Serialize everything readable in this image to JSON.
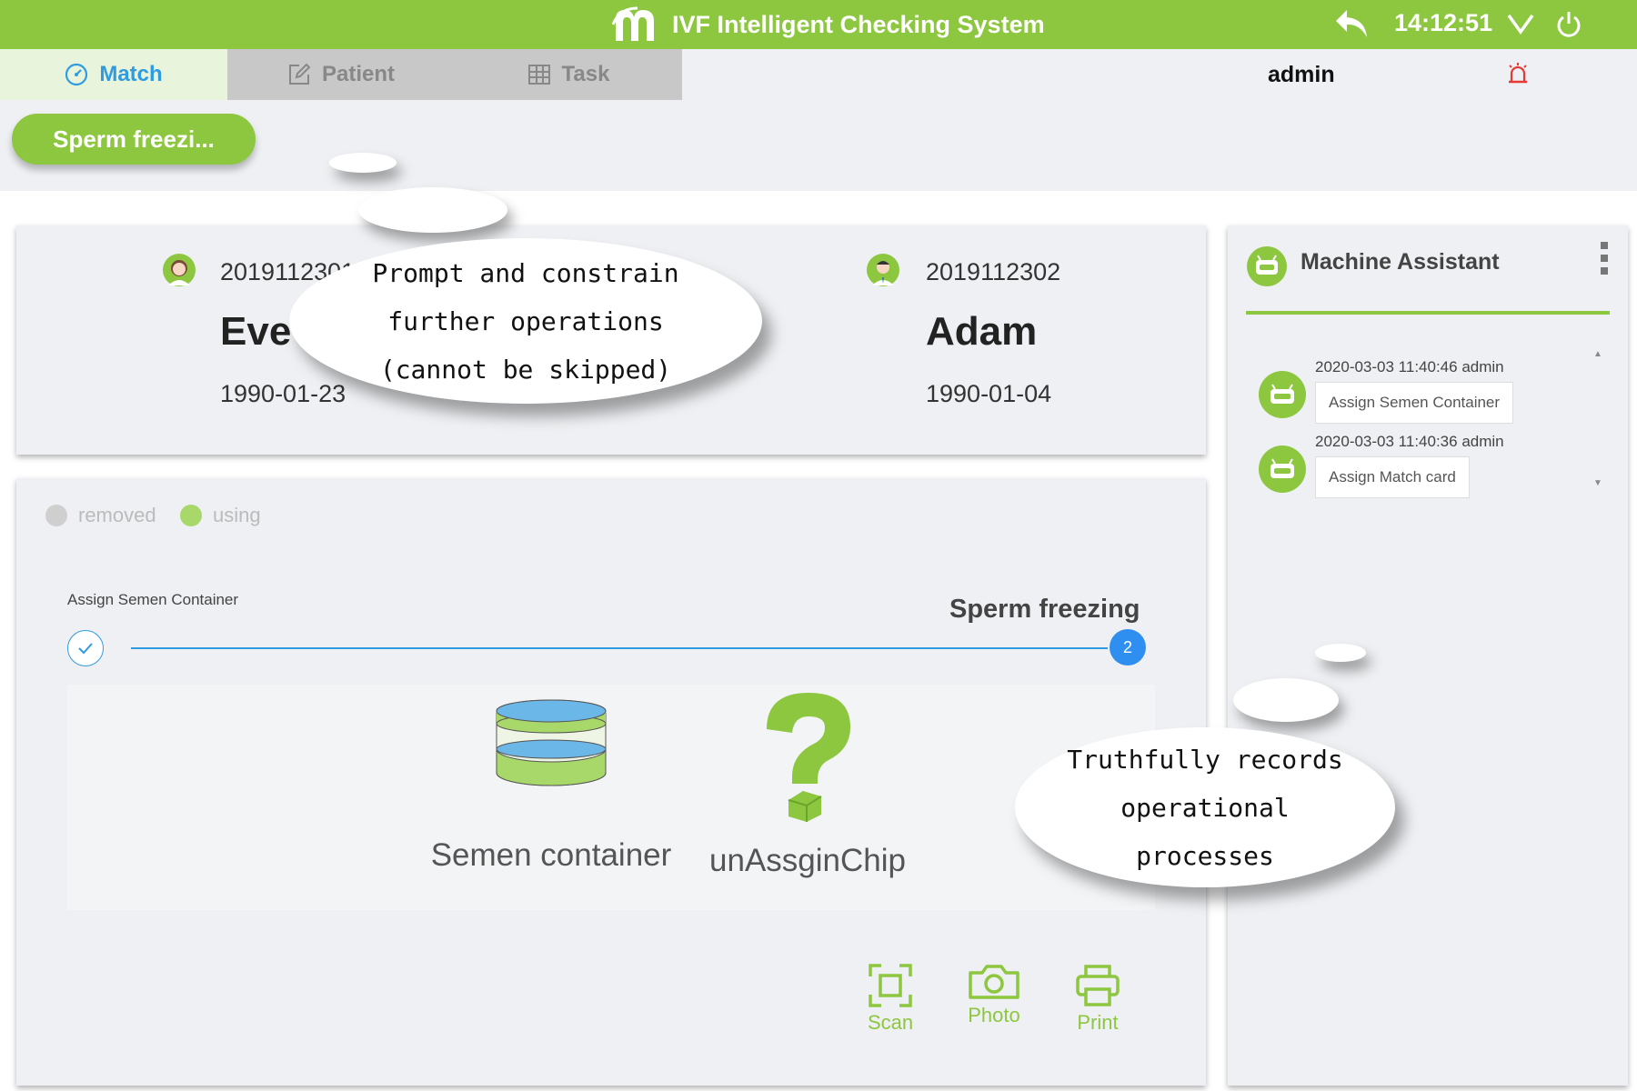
{
  "header": {
    "title": "IVF Intelligent Checking System",
    "time": "14:12:51",
    "icons": [
      "logo-icon",
      "back-icon",
      "chevron-down-icon",
      "power-icon"
    ]
  },
  "tabs": [
    {
      "label": "Match",
      "icon": "dashboard-icon",
      "active": true
    },
    {
      "label": "Patient",
      "icon": "edit-icon",
      "active": false
    },
    {
      "label": "Task",
      "icon": "table-icon",
      "active": false
    }
  ],
  "user": {
    "name": "admin",
    "alarm_icon": "alarm-icon"
  },
  "task_pill": "Sperm freezi...",
  "patients": {
    "female": {
      "id": "2019112301",
      "name": "Eve",
      "dob": "1990-01-23"
    },
    "male": {
      "id": "2019112302",
      "name": "Adam",
      "dob": "1990-01-04"
    }
  },
  "legend": {
    "removed": "removed",
    "using": "using"
  },
  "steps": {
    "done_label": "Assign Semen Container",
    "current_label": "Sperm freezing",
    "current_number": "2"
  },
  "items": {
    "container": "Semen container",
    "chip": "unAssginChip"
  },
  "actions": {
    "scan": "Scan",
    "photo": "Photo",
    "print": "Print"
  },
  "assistant": {
    "title": "Machine Assistant",
    "logs": [
      {
        "meta": "2020-03-03 11:40:46 admin",
        "message": "Assign Semen Container"
      },
      {
        "meta": "2020-03-03 11:40:36 admin",
        "message": "Assign Match card"
      }
    ]
  },
  "callouts": {
    "top": [
      "Prompt and constrain",
      "further operations",
      "(cannot be skipped)"
    ],
    "right": [
      "Truthfully records",
      "operational",
      "processes"
    ]
  },
  "colors": {
    "brand_green": "#8dc63f",
    "active_blue": "#2f9be0",
    "alarm_red": "#e53935"
  }
}
